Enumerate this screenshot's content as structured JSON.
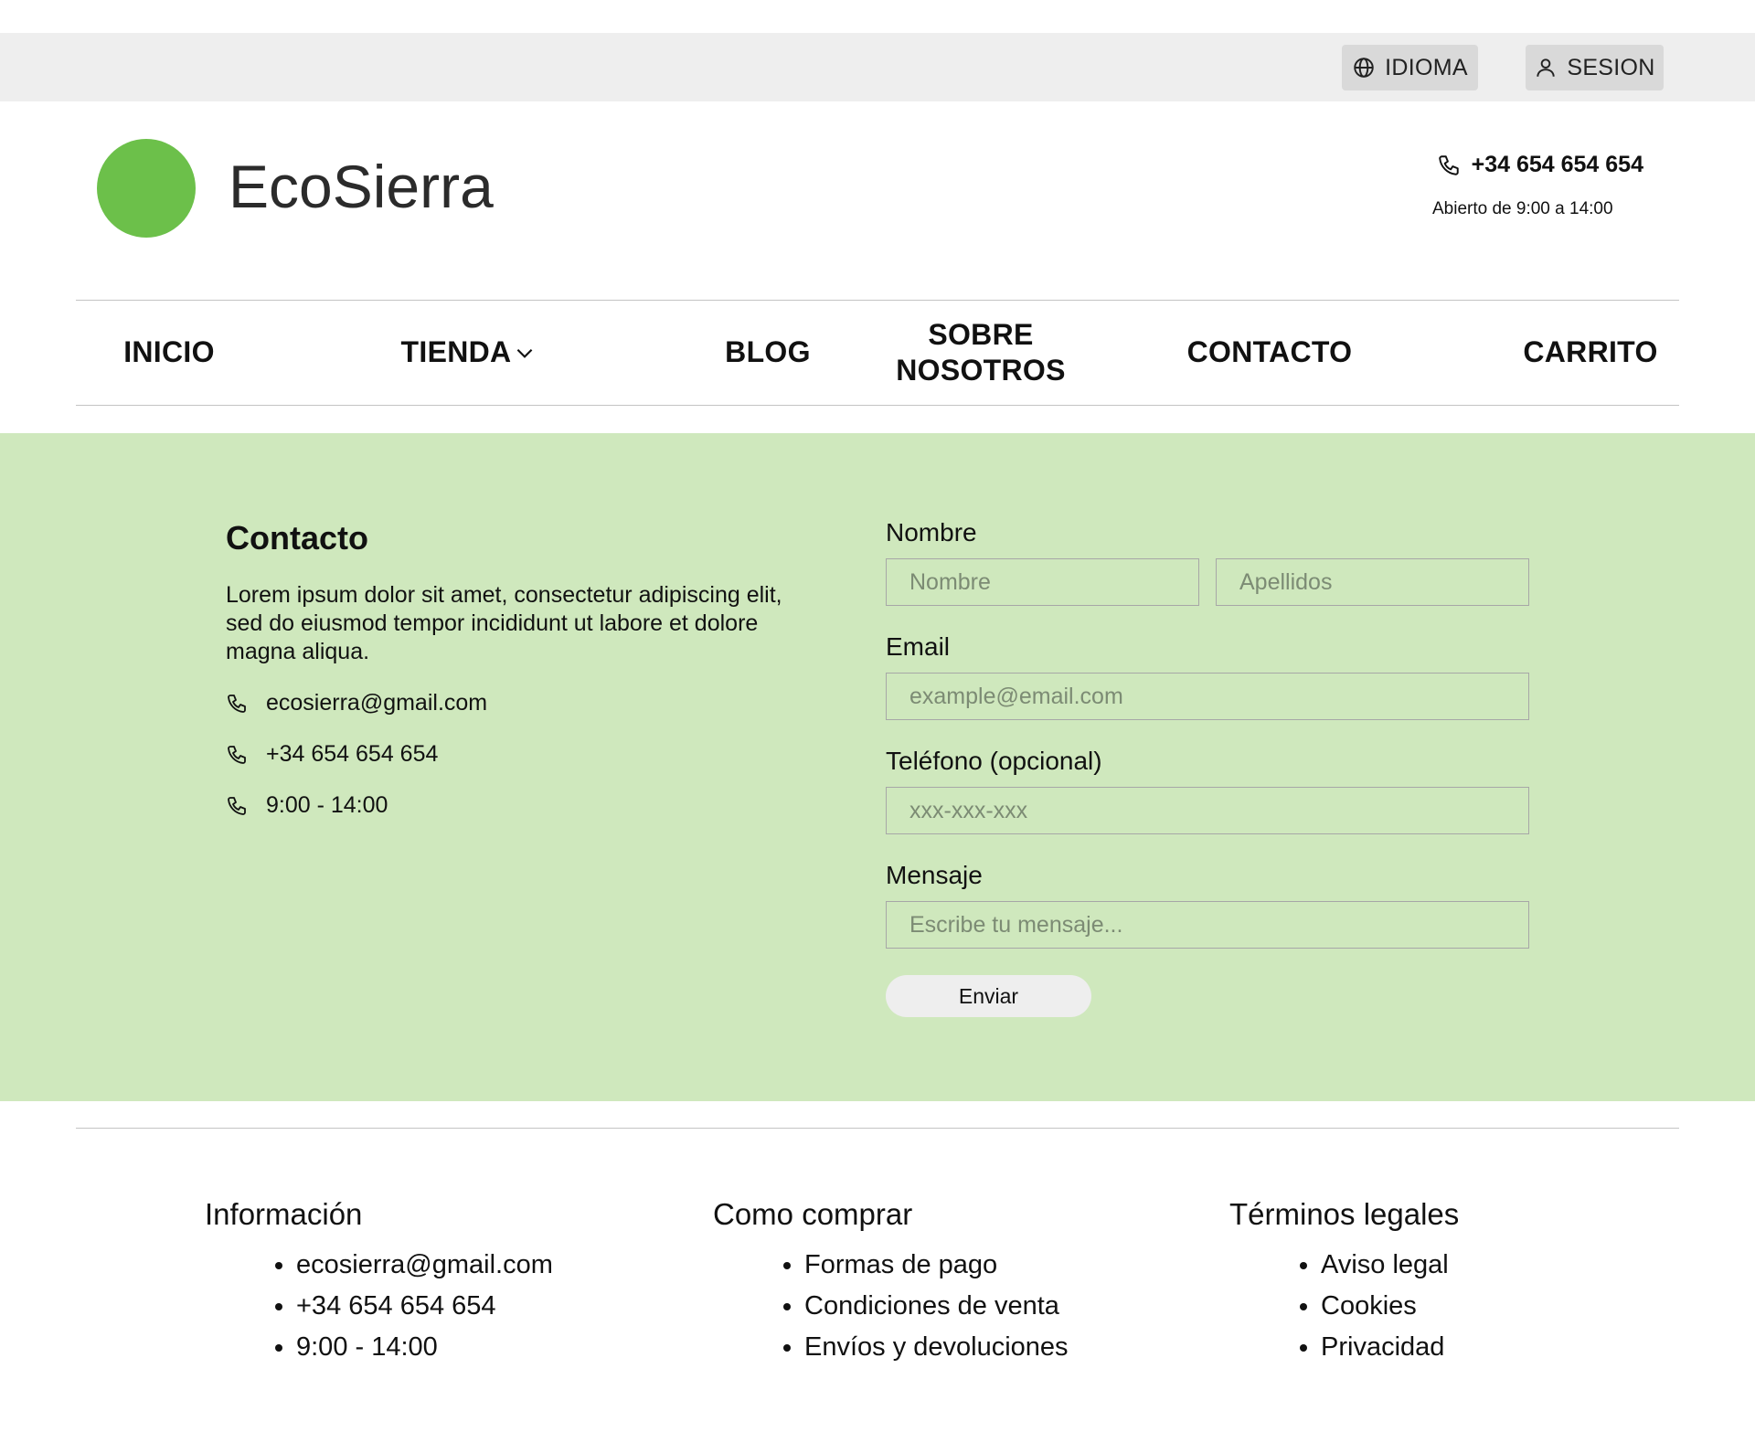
{
  "topbar": {
    "language_label": "IDIOMA",
    "session_label": "SESION"
  },
  "header": {
    "brand": "EcoSierra",
    "phone": "+34 654 654 654",
    "hours": "Abierto de 9:00 a 14:00",
    "logo_color": "#6cc04a"
  },
  "nav": {
    "items": [
      {
        "label": "INICIO"
      },
      {
        "label": "TIENDA"
      },
      {
        "label": "BLOG"
      },
      {
        "label": "SOBRE NOSOTROS"
      },
      {
        "label": "CONTACTO"
      },
      {
        "label": "CARRITO"
      }
    ]
  },
  "contact": {
    "title": "Contacto",
    "description": "Lorem ipsum dolor sit amet, consectetur adipiscing elit, sed do eiusmod tempor incididunt ut labore et dolore magna aliqua.",
    "email": "ecosierra@gmail.com",
    "phone": "+34 654 654 654",
    "hours": "9:00 - 14:00",
    "section_color": "#cfe8bd"
  },
  "form": {
    "name_label": "Nombre",
    "first_name_placeholder": "Nombre",
    "last_name_placeholder": "Apellidos",
    "email_label": "Email",
    "email_placeholder": "example@email.com",
    "phone_label": "Teléfono (opcional)",
    "phone_placeholder": "xxx-xxx-xxx",
    "message_label": "Mensaje",
    "message_placeholder": "Escribe tu mensaje...",
    "submit_label": "Enviar"
  },
  "footer": {
    "columns": [
      {
        "title": "Información",
        "items": [
          "ecosierra@gmail.com",
          "+34 654 654 654",
          "9:00 - 14:00"
        ]
      },
      {
        "title": "Como comprar",
        "items": [
          "Formas de pago",
          "Condiciones de venta",
          "Envíos y devoluciones"
        ]
      },
      {
        "title": "Términos legales",
        "items": [
          "Aviso legal",
          "Cookies",
          "Privacidad"
        ]
      }
    ]
  }
}
